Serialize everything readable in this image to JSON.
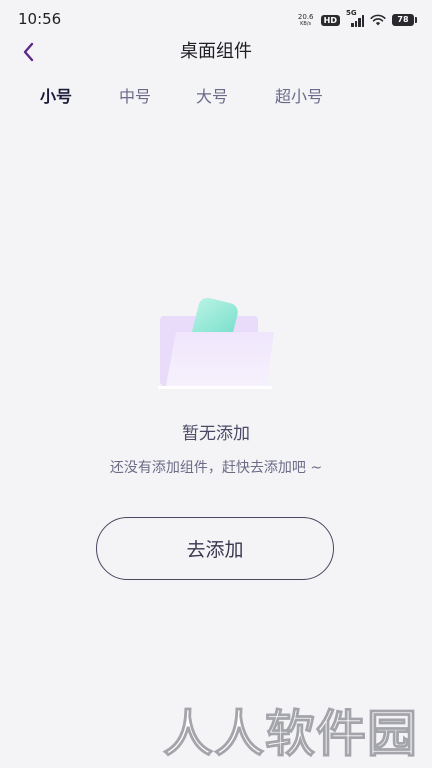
{
  "status_bar": {
    "time": "10:56",
    "net_speed_value": "20.6",
    "net_speed_unit": "KB/s",
    "hd_badge": "HD",
    "signal_label": "5G",
    "battery": "78"
  },
  "header": {
    "title": "桌面组件",
    "back_icon": "chevron-left-icon",
    "accent_color": "#5b2a86"
  },
  "tabs": [
    {
      "label": "小号",
      "active": true
    },
    {
      "label": "中号",
      "active": false
    },
    {
      "label": "大号",
      "active": false
    },
    {
      "label": "超小号",
      "active": false
    }
  ],
  "empty_state": {
    "illustration_icon": "empty-folder-icon",
    "title": "暂无添加",
    "subtitle": "还没有添加组件，赶快去添加吧 ~",
    "button_label": "去添加"
  },
  "watermark": {
    "text": "人人软件园"
  }
}
